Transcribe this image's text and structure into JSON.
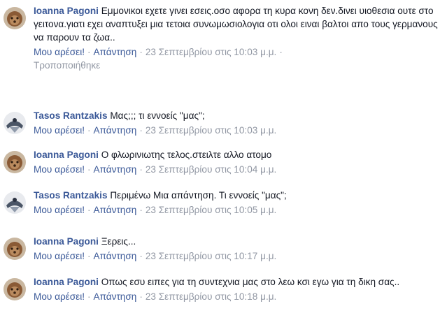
{
  "comments": [
    {
      "author": "Ioanna Pagoni",
      "avatar": "ioanna-avatar",
      "text": "Εμμονικοι εχετε γινει εσεις.οσο αφορα τη κυρα κονη δεν.δινει υιοθεσια ουτε στο γειτονα.γιατι εχει αναπτυξει μια τετοια συνωμωσιολογια οτι ολοι ειναι βαλτοι απο τους γερμανους να παρουν τα ζωα..",
      "like": "Μου αρέσει!",
      "reply": "Απάντηση",
      "time": "23 Σεπτεμβρίου στις 10:03 μ.μ.",
      "edited": "Τροποποιήθηκε"
    },
    {
      "author": "Tasos Rantzakis",
      "avatar": "tasos-avatar",
      "text": "Μας;;; τι εννοείς \"μας\";",
      "like": "Μου αρέσει!",
      "reply": "Απάντηση",
      "time": "23 Σεπτεμβρίου στις 10:03 μ.μ."
    },
    {
      "author": "Ioanna Pagoni",
      "avatar": "ioanna-avatar",
      "text": "Ο φλωρινιωτης τελος.στειλτε αλλο ατομο",
      "like": "Μου αρέσει!",
      "reply": "Απάντηση",
      "time": "23 Σεπτεμβρίου στις 10:04 μ.μ."
    },
    {
      "author": "Tasos Rantzakis",
      "avatar": "tasos-avatar",
      "text": "Περιμένω Μια απάντηση. Τι εννοείς \"μας\";",
      "like": "Μου αρέσει!",
      "reply": "Απάντηση",
      "time": "23 Σεπτεμβρίου στις 10:05 μ.μ."
    },
    {
      "author": "Ioanna Pagoni",
      "avatar": "ioanna-avatar",
      "text": "Ξερεις...",
      "like": "Μου αρέσει!",
      "reply": "Απάντηση",
      "time": "23 Σεπτεμβρίου στις 10:17 μ.μ."
    },
    {
      "author": "Ioanna Pagoni",
      "avatar": "ioanna-avatar",
      "text": "Οπως εσυ ειπες για τη συντεχνια μας στο λεω κσι εγω για τη δικη σας..",
      "like": "Μου αρέσει!",
      "reply": "Απάντηση",
      "time": "23 Σεπτεμβρίου στις 10:18 μ.μ."
    }
  ],
  "colors": {
    "author": "#3b5998",
    "text": "#141823",
    "meta": "#9197a3"
  }
}
